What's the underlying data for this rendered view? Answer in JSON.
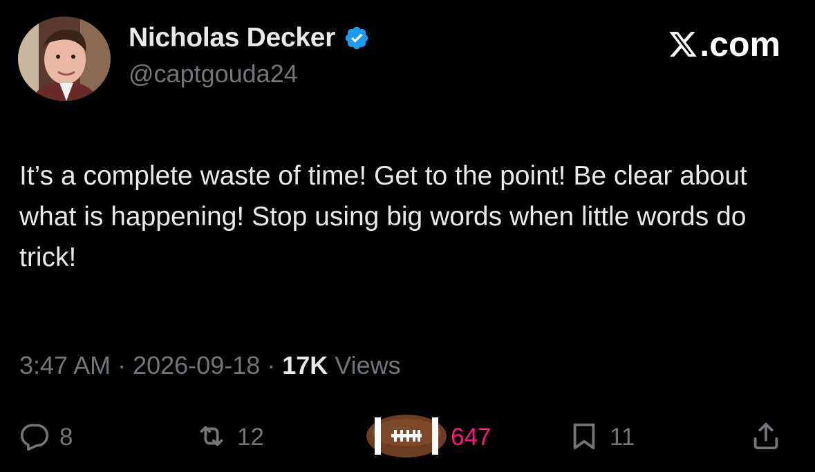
{
  "author": {
    "display_name": "Nicholas Decker",
    "handle": "@captgouda24",
    "verified": true
  },
  "brand": {
    "text": ".com",
    "icon": "x-logo-icon"
  },
  "tweet": {
    "text": "It’s a complete waste of time! Get to the point! Be clear about what is happening! Stop using big words when little words do trick!"
  },
  "meta": {
    "time": "3:47 AM",
    "separator": "·",
    "date": "2026-09-18",
    "views_count": "17K",
    "views_label": "Views"
  },
  "actions": {
    "reply": {
      "icon": "reply-icon",
      "count": "8"
    },
    "repost": {
      "icon": "repost-icon",
      "count": "12"
    },
    "like": {
      "icon": "football-like-icon",
      "count": "647"
    },
    "bookmark": {
      "icon": "bookmark-icon",
      "count": "11"
    },
    "share": {
      "icon": "share-icon"
    }
  },
  "colors": {
    "background": "#000000",
    "text": "#e7e9ea",
    "secondary": "#71767b",
    "verified": "#1d9bf0",
    "like": "#f91880"
  }
}
